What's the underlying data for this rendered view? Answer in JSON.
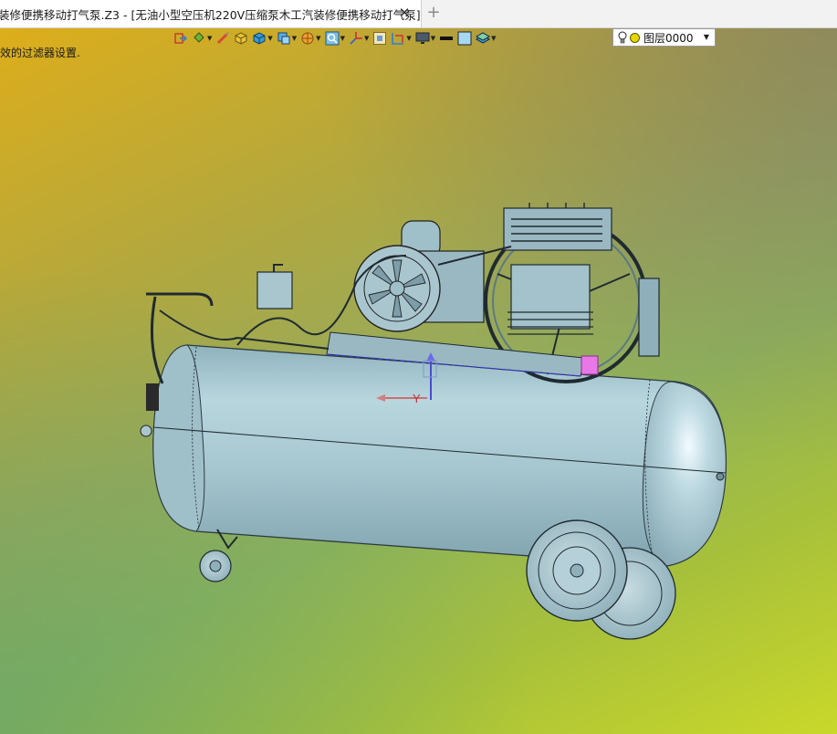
{
  "tab": {
    "title": "装修便携移动打气泵.Z3 - [无油小型空压机220V压缩泵木工汽装修便携移动打气泵]",
    "close_glyph": "✕",
    "new_tab_glyph": "+"
  },
  "status": {
    "message": "效的过滤器设置."
  },
  "toolbar": {
    "buttons": [
      {
        "icon": "exit-icon",
        "dropdown": false
      },
      {
        "icon": "paint-bucket-icon",
        "dropdown": true
      },
      {
        "icon": "pen-brush-icon",
        "dropdown": false
      },
      {
        "icon": "box-yellow-icon",
        "dropdown": false
      },
      {
        "icon": "box-blue-icon",
        "dropdown": true
      },
      {
        "icon": "box-faces-icon",
        "dropdown": true
      },
      {
        "icon": "sphere-grid-icon",
        "dropdown": true
      },
      {
        "icon": "zoom-view-icon",
        "dropdown": true
      },
      {
        "icon": "axis-triad-icon",
        "dropdown": true
      },
      {
        "icon": "frame-icon",
        "dropdown": false
      },
      {
        "icon": "dimension-icon",
        "dropdown": true
      },
      {
        "icon": "monitor-icon",
        "dropdown": true
      },
      {
        "icon": "line-black-icon",
        "dropdown": false
      },
      {
        "icon": "color-swatch-icon",
        "dropdown": false
      },
      {
        "icon": "layers-icon",
        "dropdown": true
      }
    ]
  },
  "layer": {
    "label": "图层0000",
    "bulb_icon": "lightbulb-icon",
    "color": "#e6d800"
  },
  "viewport": {
    "triad_label": "Y",
    "model_color": "#a9c6cf",
    "highlight_color": "#e878e8",
    "axis_color": "#3a3adc"
  }
}
